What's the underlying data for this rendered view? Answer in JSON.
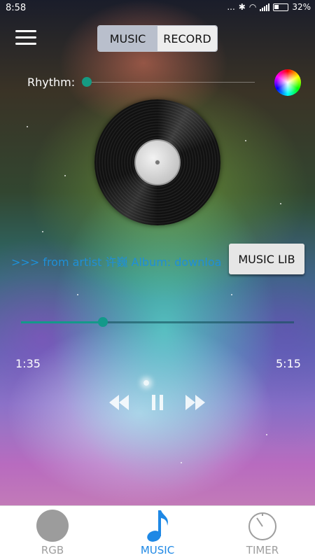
{
  "status_bar": {
    "time": "8:58",
    "battery": "32%",
    "overflow": "..."
  },
  "header": {
    "tabs": [
      {
        "label": "MUSIC",
        "active": true
      },
      {
        "label": "RECORD",
        "active": false
      }
    ]
  },
  "rhythm": {
    "label": "Rhythm:",
    "level": 0
  },
  "now_playing": {
    "info": ">>> from artist 许巍 Album: downloa",
    "music_lib_label": "MUSIC LIB",
    "current_time": "1:35",
    "total_time": "5:15",
    "progress": 0.301
  },
  "bottom_nav": {
    "items": [
      {
        "label": "RGB",
        "icon": "rgb-circle-icon",
        "active": false
      },
      {
        "label": "MUSIC",
        "icon": "music-note-icon",
        "active": true
      },
      {
        "label": "TIMER",
        "icon": "timer-icon",
        "active": false
      }
    ]
  },
  "colors": {
    "accent": "#13998a",
    "nav_active": "#1e88e5",
    "nav_inactive": "#9e9e9e",
    "link_text": "#1f8fd8"
  }
}
